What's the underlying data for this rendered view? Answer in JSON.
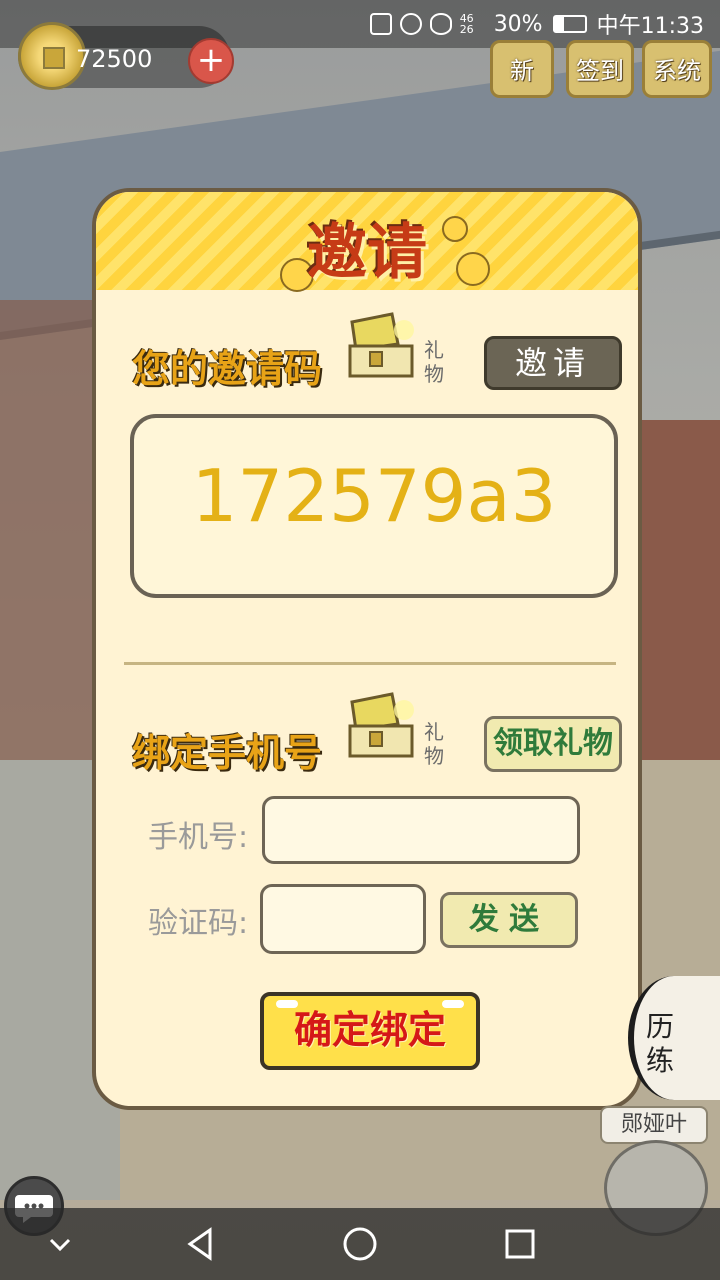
{
  "status_bar": {
    "network": "46 26",
    "battery": "30%",
    "time": "中午11:33"
  },
  "hud": {
    "coins": "72500",
    "plus_label": "+",
    "buttons": [
      "新",
      "签到",
      "系统"
    ]
  },
  "dialog": {
    "title": "邀请",
    "invite_section": {
      "title": "您的邀请码",
      "gift_label": "礼物",
      "invite_button": "邀请",
      "code": "172579a3"
    },
    "bind_section": {
      "title": "绑定手机号",
      "gift_label": "礼物",
      "claim_button": "领取礼物",
      "phone_label": "手机号:",
      "phone_value": "",
      "code_label": "验证码:",
      "code_value": "",
      "send_button": "发送",
      "confirm_button": "确定绑定"
    }
  },
  "side": {
    "training": "历练",
    "npc_name": "郧娅叶"
  },
  "colors": {
    "dialog_bg": "#fff3d3",
    "title_red": "#c63b16",
    "code_gold": "#e4b116",
    "confirm_yellow": "#ffe04a"
  },
  "icons": [
    "coin-icon",
    "plus-icon",
    "treasure-chest-icon",
    "chat-icon",
    "back-icon",
    "home-icon",
    "recent-apps-icon"
  ]
}
